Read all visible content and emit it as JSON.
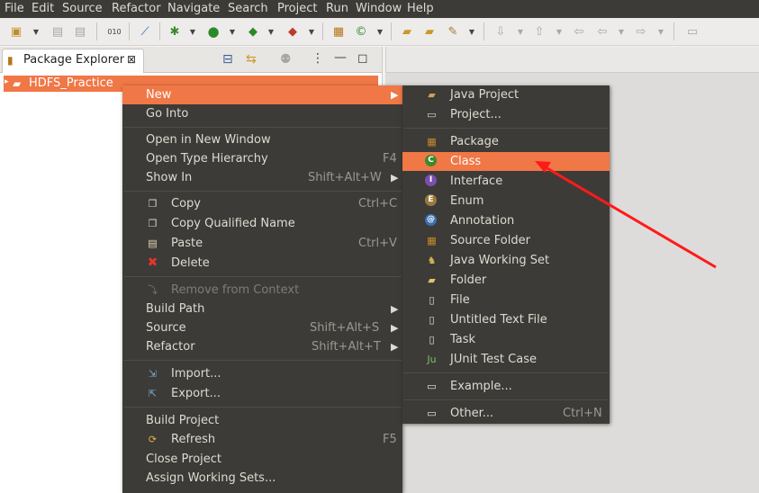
{
  "menubar": [
    "File",
    "Edit",
    "Source",
    "Refactor",
    "Navigate",
    "Search",
    "Project",
    "Run",
    "Window",
    "Help"
  ],
  "view": {
    "title": "Package Explorer",
    "close_glyph": "⊠"
  },
  "tree": {
    "project": "HDFS_Practice"
  },
  "context_menu": {
    "new": "New",
    "go_into": "Go Into",
    "open_new_window": "Open in New Window",
    "open_type_hierarchy": "Open Type Hierarchy",
    "open_type_hierarchy_key": "F4",
    "show_in": "Show In",
    "show_in_key": "Shift+Alt+W",
    "copy": "Copy",
    "copy_key": "Ctrl+C",
    "copy_qualified": "Copy Qualified Name",
    "paste": "Paste",
    "paste_key": "Ctrl+V",
    "delete": "Delete",
    "remove_context": "Remove from Context",
    "build_path": "Build Path",
    "source": "Source",
    "source_key": "Shift+Alt+S",
    "refactor": "Refactor",
    "refactor_key": "Shift+Alt+T",
    "import": "Import...",
    "export": "Export...",
    "build_project": "Build Project",
    "refresh": "Refresh",
    "refresh_key": "F5",
    "close_project": "Close Project",
    "assign_sets": "Assign Working Sets..."
  },
  "submenu": {
    "java_project": "Java Project",
    "project": "Project...",
    "package": "Package",
    "class": "Class",
    "interface": "Interface",
    "enum": "Enum",
    "annotation": "Annotation",
    "source_folder": "Source Folder",
    "java_working_set": "Java Working Set",
    "folder": "Folder",
    "file": "File",
    "untitled_text_file": "Untitled Text File",
    "task": "Task",
    "junit_test_case": "JUnit Test Case",
    "example": "Example...",
    "other": "Other...",
    "other_key": "Ctrl+N"
  },
  "colors": {
    "highlight": "#f07746",
    "menu_bg": "#3c3b37",
    "arrow": "#ff1a1a"
  }
}
